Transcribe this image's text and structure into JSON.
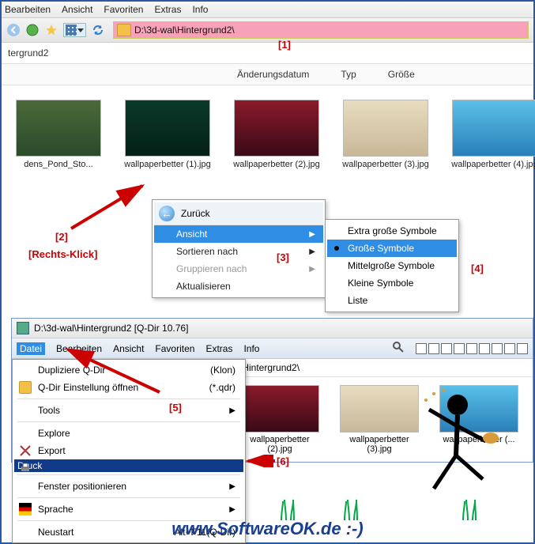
{
  "menubar": {
    "items": [
      "Bearbeiten",
      "Ansicht",
      "Favoriten",
      "Extras",
      "Info"
    ]
  },
  "address": {
    "path": "D:\\3d-wal\\Hintergrund2\\"
  },
  "breadcrumb": "tergrund2",
  "columns": [
    "",
    "Änderungsdatum",
    "Typ",
    "Größe"
  ],
  "thumbs": [
    {
      "cap": "dens_Pond_Sto..."
    },
    {
      "cap": "wallpaperbetter (1).jpg"
    },
    {
      "cap": "wallpaperbetter (2).jpg"
    },
    {
      "cap": "wallpaperbetter (3).jpg"
    },
    {
      "cap": "wallpaperbetter (4).jpg"
    }
  ],
  "context": {
    "back": "Zurück",
    "items": [
      {
        "label": "Ansicht",
        "hi": true,
        "sub": true
      },
      {
        "label": "Sortieren nach",
        "sub": true
      },
      {
        "label": "Gruppieren nach",
        "sub": true,
        "disabled": true
      },
      {
        "label": "Aktualisieren"
      }
    ],
    "submenu": [
      {
        "label": "Extra große Symbole"
      },
      {
        "label": "Große Symbole",
        "hi": true,
        "dot": true
      },
      {
        "label": "Mittelgroße Symbole"
      },
      {
        "label": "Kleine Symbole"
      },
      {
        "label": "Liste"
      }
    ]
  },
  "qdir": {
    "title": "D:\\3d-wal\\Hintergrund2  [Q-Dir 10.76]",
    "menu": [
      "Datei",
      "Bearbeiten",
      "Ansicht",
      "Favoriten",
      "Extras",
      "Info"
    ],
    "addr_tab": "\\Hintergrund2\\",
    "thumbs": [
      {
        "cap": "wallpaperbetter (2).jpg"
      },
      {
        "cap": "wallpaperbetter (3).jpg"
      },
      {
        "cap": "wallpaperbetter (..."
      }
    ],
    "filemenu": [
      {
        "label": "Dupliziere Q-Dir",
        "hint": "(Klon)"
      },
      {
        "label": "Q-Dir Einstellung öffnen",
        "hint": "(*.qdr)",
        "ico": "folder"
      },
      {
        "sep": true
      },
      {
        "label": "Tools",
        "sub": true
      },
      {
        "sep": true
      },
      {
        "label": "Explore"
      },
      {
        "label": "Export",
        "ico": "export"
      },
      {
        "label": "Druck",
        "hi": true,
        "ico": "print"
      },
      {
        "sep": true
      },
      {
        "label": "Fenster positionieren",
        "sub": true
      },
      {
        "sep": true
      },
      {
        "label": "Sprache",
        "sub": true,
        "ico": "flag"
      },
      {
        "sep": true
      },
      {
        "label": "Neustart",
        "hint": "Alt+F11(Q-Dir)"
      }
    ]
  },
  "annos": {
    "a1": "[1]",
    "a2": "[2]",
    "a2b": "[Rechts-Klick]",
    "a3": "[3]",
    "a4": "[4]",
    "a5": "[5]",
    "a6": "[6]"
  },
  "footer": "www.SoftwareOK.de :-)"
}
